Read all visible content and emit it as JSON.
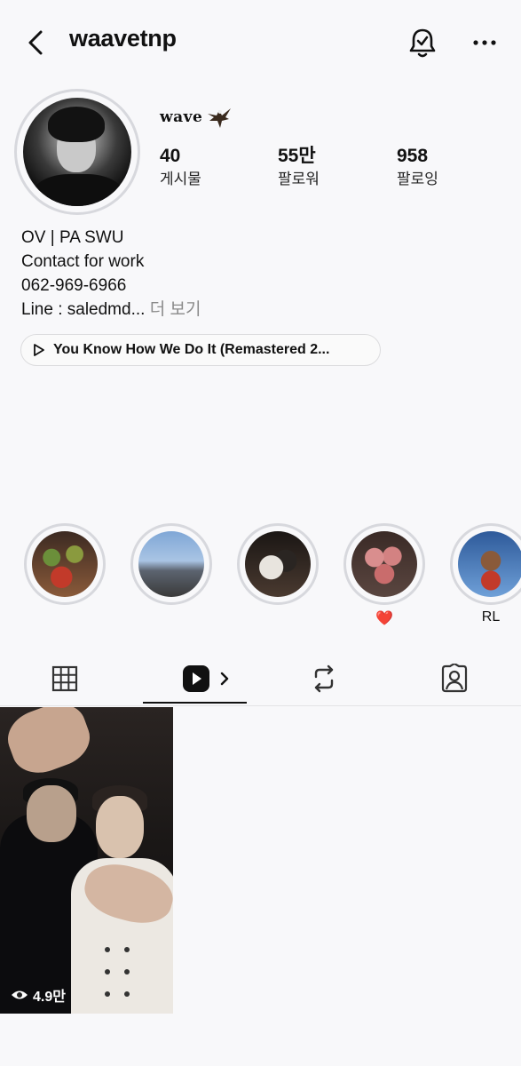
{
  "header": {
    "username": "waavetnp"
  },
  "profile": {
    "display_name": "wave",
    "stats": [
      {
        "value": "40",
        "label": "게시물"
      },
      {
        "value": "55만",
        "label": "팔로워"
      },
      {
        "value": "958",
        "label": "팔로잉"
      }
    ],
    "bio_lines": [
      "OV | PA SWU",
      "Contact for work",
      "062-969-6966",
      "Line : saledmd..."
    ],
    "bio_more": "더 보기",
    "music": "You Know How We Do It (Remastered 2..."
  },
  "highlights": [
    {
      "label": ""
    },
    {
      "label": ""
    },
    {
      "label": ""
    },
    {
      "label": "❤️"
    },
    {
      "label": "RL"
    }
  ],
  "tabs": [
    "grid-icon",
    "reels-icon",
    "reposts-icon",
    "tagged-icon"
  ],
  "reel": {
    "views": "4.9만"
  },
  "colors": {
    "background": "#f8f8fa",
    "ring": "#d7d8dd",
    "text": "#111111",
    "muted": "#8a8a8a"
  }
}
